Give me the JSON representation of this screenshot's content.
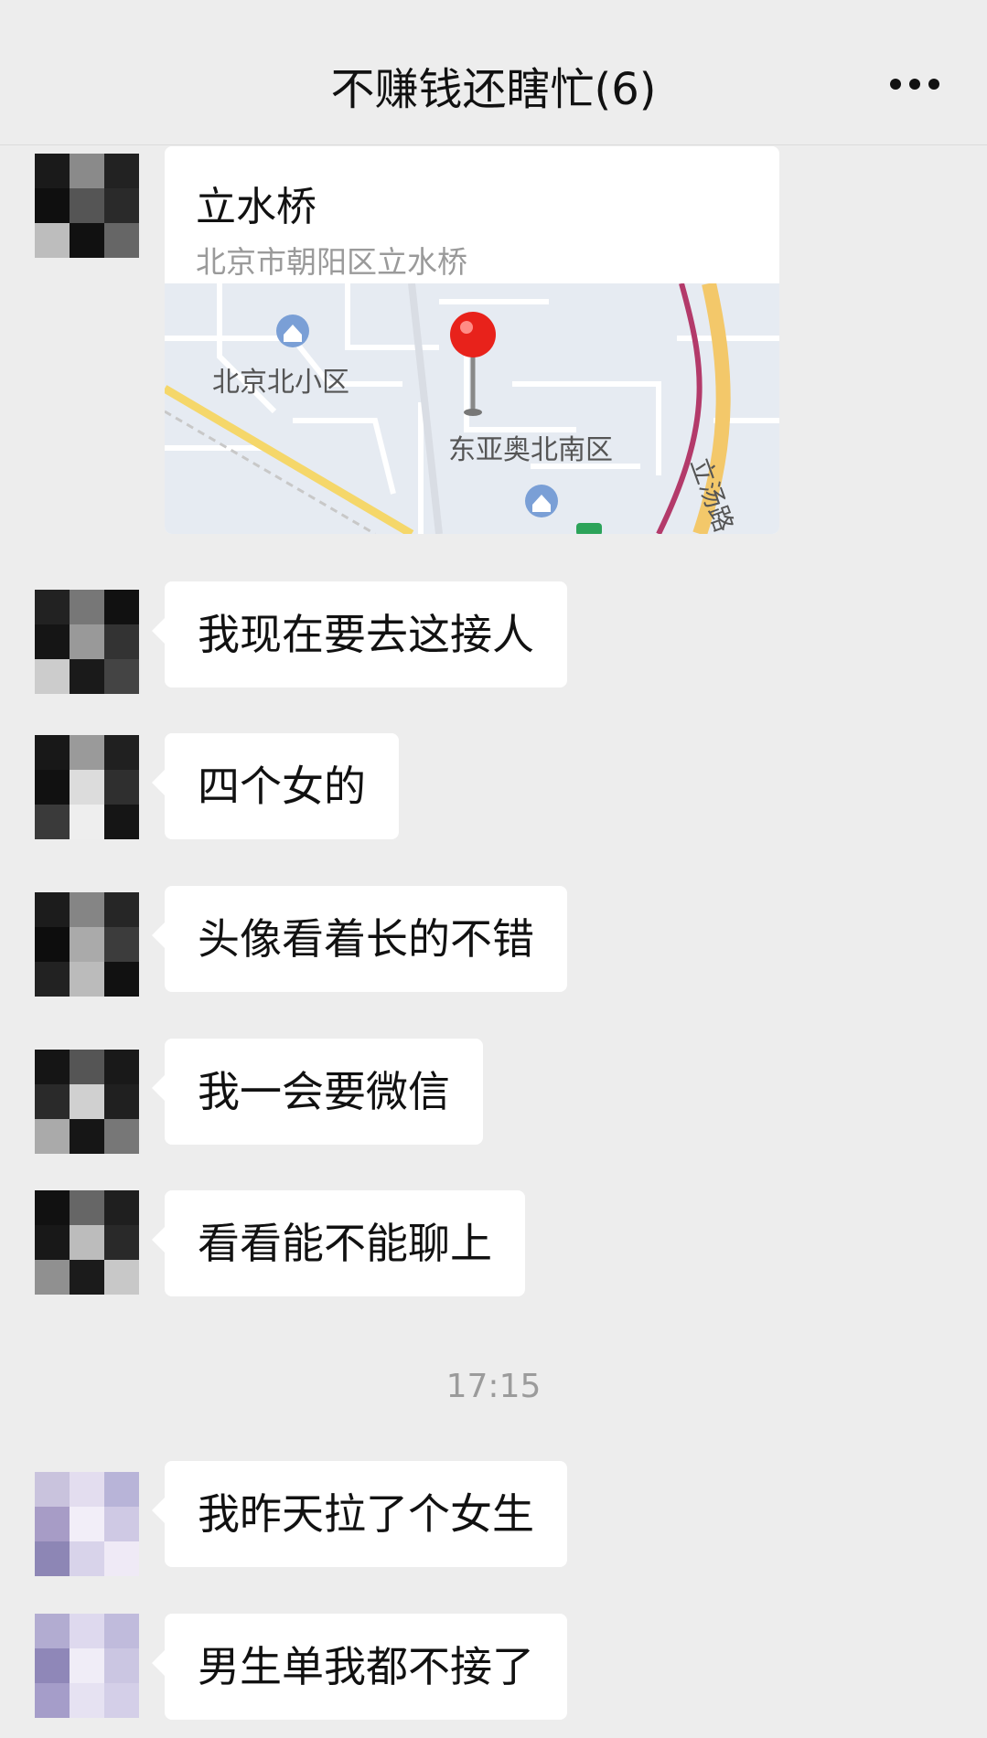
{
  "header": {
    "title": "不赚钱还瞎忙(6)",
    "more_icon": "more-dots-icon"
  },
  "messages": [
    {
      "type": "location",
      "name": "立水桥",
      "address": "北京市朝阳区立水桥",
      "map_labels": [
        "北京北小区",
        "东亚奥北南区",
        "立汤路"
      ]
    },
    {
      "type": "text",
      "text": "我现在要去这接人"
    },
    {
      "type": "text",
      "text": "四个女的"
    },
    {
      "type": "text",
      "text": "头像看着长的不错"
    },
    {
      "type": "text",
      "text": "我一会要微信"
    },
    {
      "type": "text",
      "text": "看看能不能聊上"
    },
    {
      "type": "text",
      "text": "我昨天拉了个女生"
    },
    {
      "type": "text",
      "text": "男生单我都不接了"
    }
  ],
  "timestamp": "17:15",
  "colors": {
    "background": "#ededed",
    "bubble": "#ffffff",
    "map_pin": "#e8221b"
  }
}
